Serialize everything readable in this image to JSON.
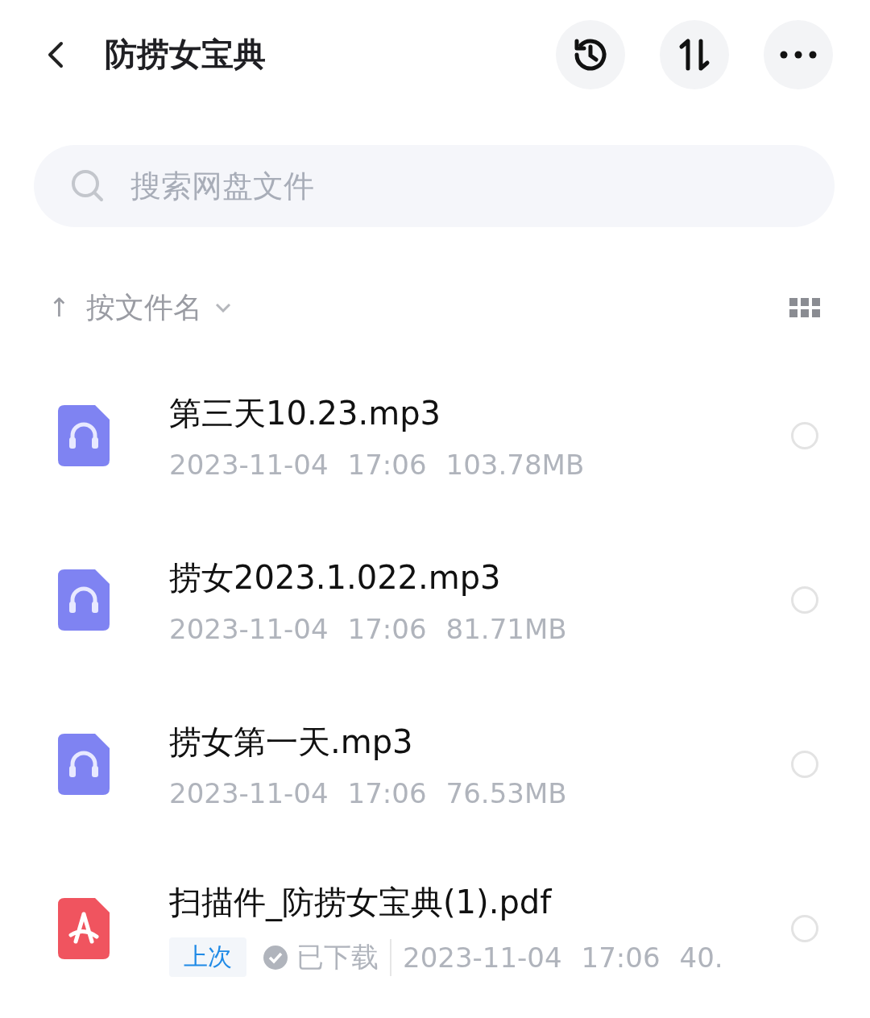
{
  "header": {
    "title": "防捞女宝典"
  },
  "search": {
    "placeholder": "搜索网盘文件"
  },
  "sort": {
    "arrow": "↑",
    "label": "按文件名"
  },
  "files": [
    {
      "kind": "audio",
      "name": "第三天10.23.mp3",
      "date": "2023-11-04",
      "time": "17:06",
      "size": "103.78MB",
      "selected": false
    },
    {
      "kind": "audio",
      "name": "捞女2023.1.022.mp3",
      "date": "2023-11-04",
      "time": "17:06",
      "size": "81.71MB",
      "selected": false
    },
    {
      "kind": "audio",
      "name": "捞女第一天.mp3",
      "date": "2023-11-04",
      "time": "17:06",
      "size": "76.53MB",
      "selected": false
    },
    {
      "kind": "pdf",
      "name": "扫描件_防捞女宝典(1).pdf",
      "tag": "上次",
      "status": "已下载",
      "date": "2023-11-04",
      "time": "17:06",
      "size": "40.",
      "selected": false
    }
  ]
}
